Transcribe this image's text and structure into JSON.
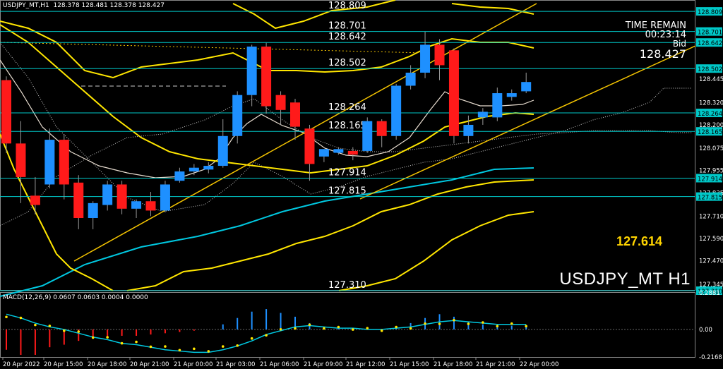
{
  "header": {
    "symbol_label": "USDJPY_MT,H1",
    "ohlc": "128.378 128.481 128.378 128.427"
  },
  "info": {
    "time_remain_label": "TIME REMAIN",
    "time_remain_value": "00:23:14",
    "bid_label": "Bid",
    "bid_value": "128.427"
  },
  "big_level": "127.614",
  "watermark": "USDJPY_MT H1",
  "macd_header": "MACD(12,26,9) 0.0607 0.0603 0.0004 0.0000",
  "colors": {
    "background": "#000000",
    "bull": "#1e90ff",
    "bear": "#ff1a1a",
    "level_line": "#00c8c8",
    "trend_line": "#f4c400",
    "bb": "#ffe600",
    "ma_slow": "#00c8e0",
    "ma_fast": "#e8ddd0",
    "ichimoku": "#c8c8c8"
  },
  "chart_data": {
    "type": "candlestick",
    "symbol": "USDJPY_MT",
    "timeframe": "H1",
    "ylim": [
      127.31,
      128.87
    ],
    "y_ticks": [
      "128.809",
      "128.701",
      "128.642",
      "128.502",
      "128.445",
      "128.320",
      "128.264",
      "128.200",
      "128.165",
      "128.075",
      "127.955",
      "127.914",
      "127.835",
      "127.815",
      "127.710",
      "127.590",
      "127.470",
      "127.345",
      "127.310"
    ],
    "x_ticks": [
      "20 Apr 2022",
      "20 Apr 15:00",
      "20 Apr 18:00",
      "20 Apr 21:00",
      "21 Apr 00:00",
      "21 Apr 03:00",
      "21 Apr 06:00",
      "21 Apr 09:00",
      "21 Apr 12:00",
      "21 Apr 15:00",
      "21 Apr 18:00",
      "21 Apr 21:00",
      "22 Apr 00:00"
    ],
    "levels": [
      {
        "label": "128.809",
        "value": 128.809
      },
      {
        "label": "128.701",
        "value": 128.701
      },
      {
        "label": "128.642",
        "value": 128.642
      },
      {
        "label": "128.502",
        "value": 128.502
      },
      {
        "label": "128.264",
        "value": 128.264
      },
      {
        "label": "128.165",
        "value": 128.165
      },
      {
        "label": "127.914",
        "value": 127.914
      },
      {
        "label": "127.815",
        "value": 127.815
      },
      {
        "label": "127.310",
        "value": 127.31
      }
    ],
    "candles": [
      {
        "o": 128.44,
        "h": 128.46,
        "c": 128.1,
        "l": 128.05
      },
      {
        "o": 128.1,
        "h": 128.22,
        "c": 127.92,
        "l": 127.78
      },
      {
        "o": 127.82,
        "h": 127.92,
        "c": 127.77,
        "l": 127.72
      },
      {
        "o": 127.88,
        "h": 128.18,
        "c": 128.12,
        "l": 127.86
      },
      {
        "o": 128.12,
        "h": 128.15,
        "c": 127.88,
        "l": 127.8
      },
      {
        "o": 127.89,
        "h": 127.93,
        "c": 127.7,
        "l": 127.64
      },
      {
        "o": 127.7,
        "h": 127.79,
        "c": 127.78,
        "l": 127.64
      },
      {
        "o": 127.77,
        "h": 127.9,
        "c": 127.88,
        "l": 127.74
      },
      {
        "o": 127.88,
        "h": 127.9,
        "c": 127.75,
        "l": 127.72
      },
      {
        "o": 127.75,
        "h": 127.8,
        "c": 127.79,
        "l": 127.7
      },
      {
        "o": 127.79,
        "h": 127.84,
        "c": 127.74,
        "l": 127.71
      },
      {
        "o": 127.74,
        "h": 127.9,
        "c": 127.88,
        "l": 127.73
      },
      {
        "o": 127.9,
        "h": 127.97,
        "c": 127.95,
        "l": 127.89
      },
      {
        "o": 127.95,
        "h": 127.99,
        "c": 127.97,
        "l": 127.93
      },
      {
        "o": 127.96,
        "h": 128.0,
        "c": 127.98,
        "l": 127.94
      },
      {
        "o": 127.98,
        "h": 128.23,
        "c": 128.14,
        "l": 127.97
      },
      {
        "o": 128.14,
        "h": 128.38,
        "c": 128.36,
        "l": 128.1
      },
      {
        "o": 128.36,
        "h": 128.63,
        "c": 128.62,
        "l": 128.3
      },
      {
        "o": 128.62,
        "h": 128.64,
        "c": 128.3,
        "l": 128.26
      },
      {
        "o": 128.36,
        "h": 128.38,
        "c": 128.28,
        "l": 128.2
      },
      {
        "o": 128.32,
        "h": 128.34,
        "c": 128.19,
        "l": 128.12
      },
      {
        "o": 128.18,
        "h": 128.2,
        "c": 127.99,
        "l": 127.9
      },
      {
        "o": 128.03,
        "h": 128.07,
        "c": 128.07,
        "l": 128.0
      },
      {
        "o": 128.05,
        "h": 128.08,
        "c": 128.07,
        "l": 128.04
      },
      {
        "o": 128.06,
        "h": 128.08,
        "c": 128.04,
        "l": 128.01
      },
      {
        "o": 128.06,
        "h": 128.24,
        "c": 128.22,
        "l": 128.05
      },
      {
        "o": 128.22,
        "h": 128.23,
        "c": 128.14,
        "l": 128.08
      },
      {
        "o": 128.14,
        "h": 128.42,
        "c": 128.41,
        "l": 128.12
      },
      {
        "o": 128.41,
        "h": 128.52,
        "c": 128.48,
        "l": 128.39
      },
      {
        "o": 128.48,
        "h": 128.7,
        "c": 128.63,
        "l": 128.45
      },
      {
        "o": 128.63,
        "h": 128.66,
        "c": 128.52,
        "l": 128.44
      },
      {
        "o": 128.6,
        "h": 128.61,
        "c": 128.14,
        "l": 128.1
      },
      {
        "o": 128.14,
        "h": 128.25,
        "c": 128.2,
        "l": 128.1
      },
      {
        "o": 128.24,
        "h": 128.29,
        "c": 128.27,
        "l": 128.2
      },
      {
        "o": 128.24,
        "h": 128.4,
        "c": 128.37,
        "l": 128.22
      },
      {
        "o": 128.35,
        "h": 128.39,
        "c": 128.37,
        "l": 128.33
      },
      {
        "o": 128.38,
        "h": 128.48,
        "c": 128.43,
        "l": 128.37
      }
    ],
    "macd": {
      "ylim": [
        -0.2168,
        0.2881
      ],
      "y_ticks": [
        "0.2881",
        "0.00",
        "-0.2168"
      ],
      "histogram": [
        -0.16,
        -0.2,
        -0.2,
        -0.14,
        -0.12,
        -0.09,
        -0.07,
        -0.06,
        -0.05,
        -0.05,
        -0.04,
        -0.03,
        -0.02,
        -0.01,
        0.0,
        0.04,
        0.09,
        0.14,
        0.16,
        0.13,
        0.1,
        0.05,
        0.02,
        0.01,
        0.0,
        0.01,
        0.0,
        0.02,
        0.05,
        0.09,
        0.12,
        0.1,
        0.06,
        0.04,
        0.03,
        0.03,
        0.03
      ],
      "signal": [
        0.12,
        0.09,
        0.05,
        0.02,
        0.0,
        -0.03,
        -0.06,
        -0.08,
        -0.11,
        -0.12,
        -0.14,
        -0.16,
        -0.17,
        -0.18,
        -0.18,
        -0.16,
        -0.13,
        -0.09,
        -0.04,
        -0.01,
        0.02,
        0.03,
        0.02,
        0.01,
        0.01,
        0.0,
        0.0,
        0.01,
        0.02,
        0.04,
        0.06,
        0.07,
        0.06,
        0.05,
        0.04,
        0.04,
        0.04
      ]
    }
  }
}
